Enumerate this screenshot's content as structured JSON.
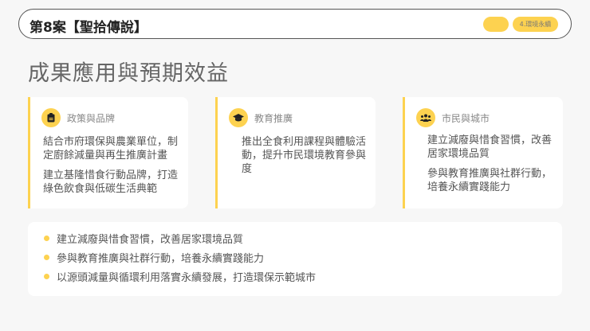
{
  "header": {
    "title": "第8案【聖拾傳說】",
    "tag": "4.環境永續"
  },
  "page_title": "成果應用與預期效益",
  "cards": [
    {
      "icon": "clipboard-icon",
      "label": "政策與品牌",
      "paragraphs": [
        "結合市府環保與農業單位，制定廚餘減量與再生推廣計畫",
        "建立基隆惜食行動品牌，打造綠色飲食與低碳生活典範"
      ]
    },
    {
      "icon": "graduation-cap-icon",
      "label": "教育推廣",
      "paragraphs": [
        "推出全食利用課程與體驗活動，提升市民環境教育參與度"
      ]
    },
    {
      "icon": "users-icon",
      "label": "市民與城市",
      "paragraphs": [
        "建立減廢與惜食習慣，改善居家環境品質",
        "參與教育推廣與社群行動，培養永續實踐能力"
      ]
    }
  ],
  "bullets": [
    "建立減廢與惜食習慣，改善居家環境品質",
    "參與教育推廣與社群行動，培養永續實踐能力",
    "以源頭減量與循環利用落實永續發展，打造環保示範城市"
  ],
  "colors": {
    "accent": "#fdd250"
  }
}
